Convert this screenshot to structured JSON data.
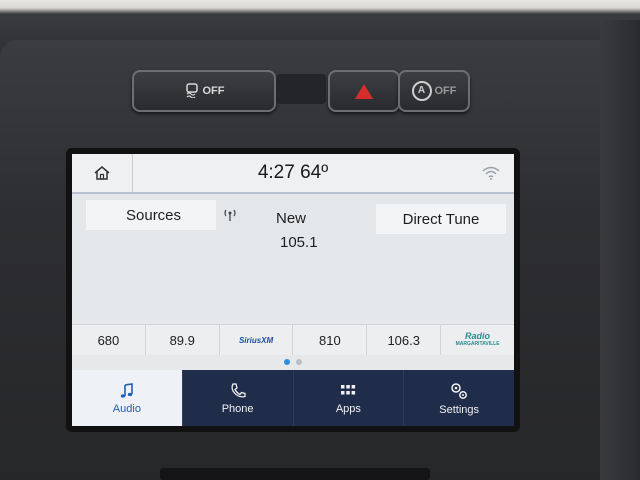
{
  "hardware_buttons": {
    "traction_off_label": "OFF",
    "auto_start_label": "OFF"
  },
  "status_bar": {
    "clock": "4:27",
    "temperature": "64º"
  },
  "radio": {
    "sources_label": "Sources",
    "station_name": "New",
    "station_freq": "105.1",
    "direct_tune_label": "Direct Tune"
  },
  "presets": [
    {
      "label": "680"
    },
    {
      "label": "89.9"
    },
    {
      "label": "SiriusXM"
    },
    {
      "label": "810"
    },
    {
      "label": "106.3"
    },
    {
      "label": "Radio",
      "sublabel": "MARGARITAVILLE"
    }
  ],
  "page_dots": {
    "active": 0,
    "count": 2
  },
  "nav": {
    "audio": "Audio",
    "phone": "Phone",
    "apps": "Apps",
    "settings": "Settings"
  },
  "colors": {
    "accent": "#2f8de0",
    "nav_bar": "#1f2c4a",
    "hazard": "#d62d2d"
  }
}
